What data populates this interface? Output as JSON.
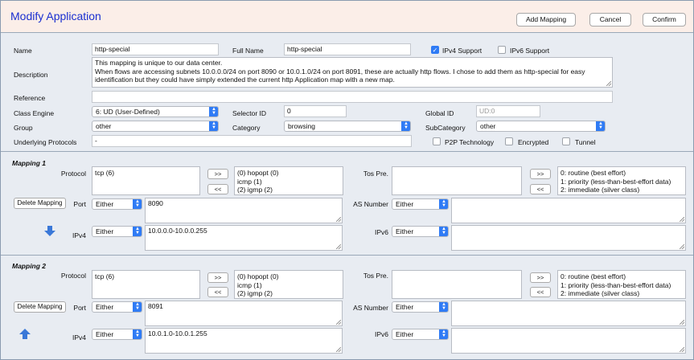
{
  "header": {
    "title": "Modify Application",
    "add_mapping": "Add Mapping",
    "cancel": "Cancel",
    "confirm": "Confirm"
  },
  "form": {
    "name_label": "Name",
    "name_value": "http-special",
    "full_name_label": "Full Name",
    "full_name_value": "http-special",
    "ipv4_support_label": "IPv4 Support",
    "ipv4_support_checked": true,
    "ipv6_support_label": "IPv6 Support",
    "ipv6_support_checked": false,
    "description_label": "Description",
    "description_lines": [
      "This mapping is unique to our data center.",
      "When flows are accessing subnets 10.0.0.0/24 on port 8090 or 10.0.1.0/24 on port 8091, these are actually http flows. I chose to add them as http-special for easy",
      "identification but they could have simply extended the current http Application map with a new map."
    ],
    "reference_label": "Reference",
    "reference_value": "",
    "class_engine_label": "Class Engine",
    "class_engine_value": "6:  UD  (User-Defined)",
    "selector_id_label": "Selector ID",
    "selector_id_value": "0",
    "global_id_label": "Global ID",
    "global_id_placeholder": "UD:0",
    "group_label": "Group",
    "group_value": "other",
    "category_label": "Category",
    "category_value": "browsing",
    "subcategory_label": "SubCategory",
    "subcategory_value": "other",
    "underlying_label": "Underlying Protocols",
    "underlying_value": "-",
    "p2p_label": "P2P Technology",
    "encrypted_label": "Encrypted",
    "tunnel_label": "Tunnel"
  },
  "mappings": [
    {
      "title": "Mapping 1",
      "protocol_label": "Protocol",
      "protocol_selected": "tcp (6)",
      "protocol_available": [
        "(0) hopopt (0)",
        "icmp (1)",
        "(2) igmp (2)"
      ],
      "add_btn": ">>",
      "remove_btn": "<<",
      "tos_label": "Tos Pre.",
      "tos_available": [
        "0:  routine (best effort)",
        "1:  priority (less-than-best-effort data)",
        "2:  immediate (silver class)"
      ],
      "delete_label": "Delete Mapping",
      "port_label": "Port",
      "port_mode": "Either",
      "port_value": "8090",
      "as_label": "AS Number",
      "as_mode": "Either",
      "ipv4_label": "IPv4",
      "ipv4_mode": "Either",
      "ipv4_value": "10.0.0.0-10.0.0.255",
      "ipv6_label": "IPv6",
      "ipv6_mode": "Either",
      "move_icon": "arrow-down-icon"
    },
    {
      "title": "Mapping 2",
      "protocol_label": "Protocol",
      "protocol_selected": "tcp (6)",
      "protocol_available": [
        "(0) hopopt (0)",
        "icmp (1)",
        "(2) igmp (2)"
      ],
      "add_btn": ">>",
      "remove_btn": "<<",
      "tos_label": "Tos Pre.",
      "tos_available": [
        "0:  routine (best effort)",
        "1:  priority (less-than-best-effort data)",
        "2:  immediate (silver class)"
      ],
      "delete_label": "Delete Mapping",
      "port_label": "Port",
      "port_mode": "Either",
      "port_value": "8091",
      "as_label": "AS Number",
      "as_mode": "Either",
      "ipv4_label": "IPv4",
      "ipv4_mode": "Either",
      "ipv4_value": "10.0.1.0-10.0.1.255",
      "ipv6_label": "IPv6",
      "ipv6_mode": "Either",
      "move_icon": "arrow-up-icon"
    }
  ],
  "colors": {
    "accent": "#2f7bf5",
    "title": "#1a2fd0",
    "header_bg": "#fbeee8",
    "panel_bg": "#e8ecf2"
  }
}
